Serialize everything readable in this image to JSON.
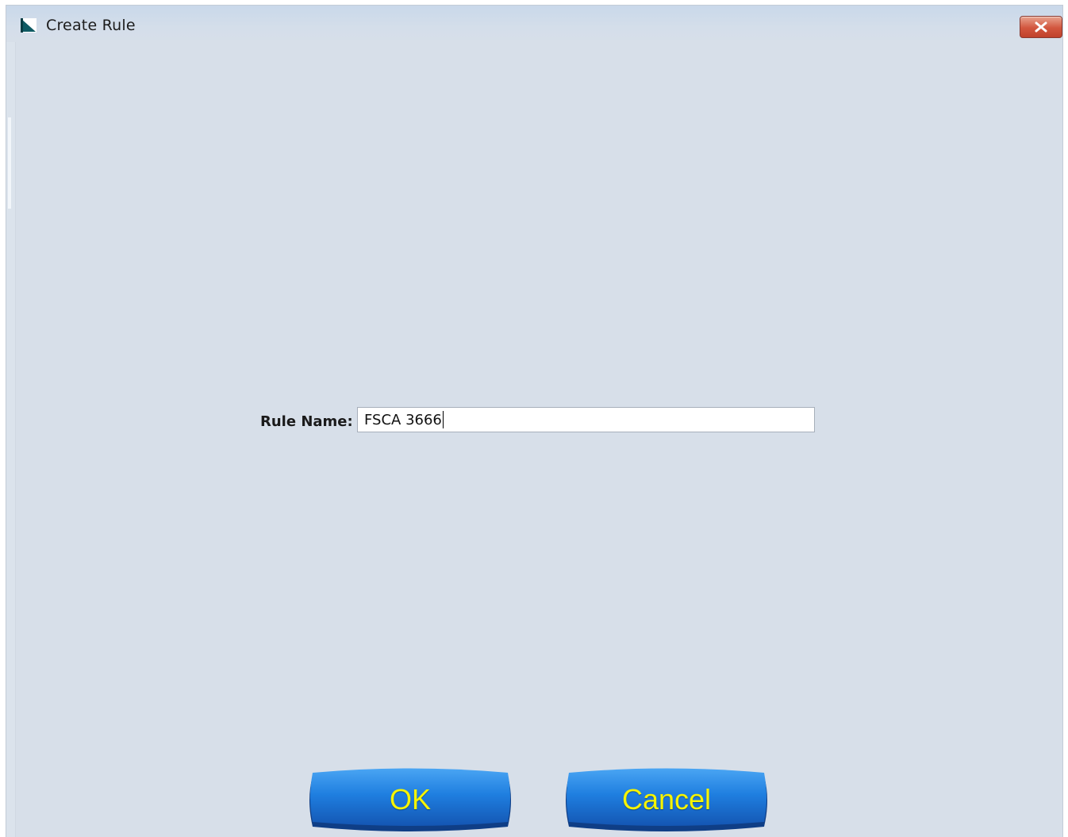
{
  "window": {
    "title": "Create Rule"
  },
  "titlebar": {
    "icons": [
      "app-icon",
      "close-icon"
    ]
  },
  "form": {
    "rule_name_label": "Rule Name:",
    "rule_name_value": "FSCA 3666"
  },
  "buttons": {
    "ok_label": "OK",
    "cancel_label": "Cancel"
  },
  "colors": {
    "background": "#d7dfe9",
    "button_blue": "#1a73d9",
    "button_text": "#f6f400",
    "close_red": "#d2563e"
  }
}
